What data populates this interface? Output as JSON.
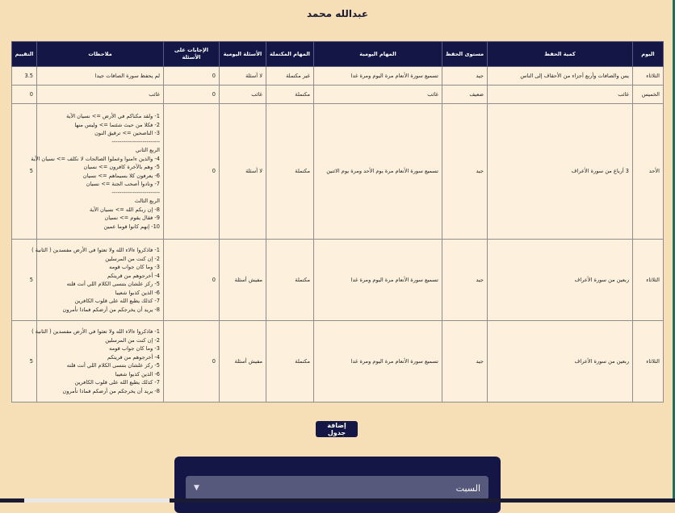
{
  "page": {
    "title": "عبدالله محمد"
  },
  "table": {
    "headers": [
      "اليوم",
      "كمية الحفظ",
      "مستوى الحفظ",
      "المهام اليومية",
      "المهام المكتملة",
      "الأسئلة اليومية",
      "الإجابات على الأسئلة",
      "ملاحظات",
      "التقييم"
    ],
    "rows": [
      {
        "day": "الثلاثاء",
        "amount": "يس والصافات وأربع أجزاء من الأحقاف إلى الناس",
        "level": "جيد",
        "tasks": "تسميع سورة الأنعام مرة اليوم ومرة غدا",
        "completed": "غير مكتملة",
        "questions": "لا أسئلة",
        "answers": "0",
        "notes": [
          "لم يحفظ سورة الصافات جيدا"
        ],
        "rating": "3.5"
      },
      {
        "day": "الخميس",
        "amount": "غائب",
        "level": "ضعيف",
        "tasks": "غائب",
        "completed": "مكتملة",
        "questions": "غائب",
        "answers": "0",
        "notes": [
          "غائب"
        ],
        "rating": "0"
      },
      {
        "day": "الأحد",
        "amount": "3 أرباع من سورة الأعراف",
        "level": "جيد",
        "tasks": "تسميع سورة الأنعام مرة يوم الأحد ومرة يوم الاثنين",
        "completed": "مكتملة",
        "questions": "لا أسئلة",
        "answers": "0",
        "notes": [
          "1- ولقد مكناكم في الأرض => نسيان الآية",
          "2- فكلا من حيث شئتما => وليس منها",
          "3- الناصحين => ترقيق النون",
          "-------------------------",
          "الربع الثاني",
          "4- والذين ءامنوا وعملوا الصالحات لا نكلف => نسيان الآية",
          "5- وهم بالآخرة كافرون => نسيان",
          "6- يعرفون كلا بسيماهم => نسيان",
          "7- ونادوا أصحب الجنة => نسيان",
          "-------------------------",
          "الربع الثالث",
          "8- إن ربكم الله => نسيان الآية",
          "9- فقال يقوم => نسيان",
          "10- إنهم كانوا قوما عمين"
        ],
        "rating": "5"
      },
      {
        "day": "الثلاثاء",
        "amount": "ربعين من سورة الأعراف",
        "level": "جيد",
        "tasks": "تسميع سورة الأنعام مرة اليوم ومرة غدا",
        "completed": "مكتملة",
        "questions": "مفيش أسئلة",
        "answers": "0",
        "notes": [
          "1- فاذكروا ءالاء الله ولا تعثوا في الأرض مفسدين ( الثانية )",
          "2- إن كنت من المرسلين",
          "3- وما كان جواب قومه",
          "4- أخرجوهم من قريتكم",
          "5- ركز علشان بتنسى الكلام اللي أنت قلته",
          "6- الذين كذبوا شعيبا",
          "7- كذلك يطبع الله على قلوب الكافرين",
          "8- يريد أن يخرجكم من أرضكم فماذا تأمرون"
        ],
        "rating": "5"
      },
      {
        "day": "الثلاثاء",
        "amount": "ربعين من سورة الأعراف",
        "level": "جيد",
        "tasks": "تسميع سورة الأنعام مرة اليوم ومرة غدا",
        "completed": "مكتملة",
        "questions": "مفيش أسئلة",
        "answers": "0",
        "notes": [
          "1- فاذكروا ءالاء الله ولا تعثوا في الأرض مفسدين ( الثانية )",
          "2- إن كنت من المرسلين",
          "3- وما كان جواب قومه",
          "4- أخرجوهم من قريتكم",
          "5- ركز علشان بتنسى الكلام اللي أنت قلته",
          "6- الذين كذبوا شعيبا",
          "7- كذلك يطبع الله على قلوب الكافرين",
          "8- يريد أن يخرجكم من أرضكم فماذا تأمرون"
        ],
        "rating": "5"
      }
    ]
  },
  "actions": {
    "add_table_label": "إضافة جدول"
  },
  "day_select": {
    "selected": "السبت"
  }
}
